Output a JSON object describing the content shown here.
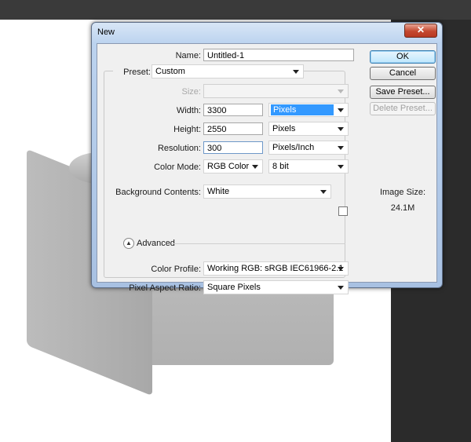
{
  "dialog": {
    "title": "New",
    "close_glyph": "✕"
  },
  "form": {
    "name_label": "Name:",
    "name_value": "Untitled-1",
    "preset_label": "Preset:",
    "preset_value": "Custom",
    "size_label": "Size:",
    "size_value": "",
    "width_label": "Width:",
    "width_value": "3300",
    "width_unit": "Pixels",
    "height_label": "Height:",
    "height_value": "2550",
    "height_unit": "Pixels",
    "resolution_label": "Resolution:",
    "resolution_value": "300",
    "resolution_unit": "Pixels/Inch",
    "color_mode_label": "Color Mode:",
    "color_mode_value": "RGB Color",
    "bit_depth_value": "8 bit",
    "background_label": "Background Contents:",
    "background_value": "White",
    "advanced_label": "Advanced",
    "color_profile_label": "Color Profile:",
    "color_profile_value": "Working RGB:  sRGB IEC61966-2.1",
    "pixel_aspect_label": "Pixel Aspect Ratio:",
    "pixel_aspect_value": "Square Pixels"
  },
  "buttons": {
    "ok": "OK",
    "cancel": "Cancel",
    "save_preset": "Save Preset...",
    "delete_preset": "Delete Preset..."
  },
  "image_size": {
    "label": "Image Size:",
    "value": "24.1M"
  },
  "icons": {
    "close": "close-icon",
    "dropdown": "chevron-down-icon",
    "advanced": "chevron-up-icon"
  },
  "colors": {
    "selection": "#3399ff",
    "close_button": "#c4482f",
    "dialog_frame": "#bcd3ef"
  }
}
